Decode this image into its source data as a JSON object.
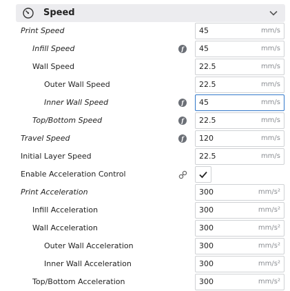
{
  "section": {
    "title": "Speed",
    "icon": "speedometer-icon",
    "collapse_icon": "chevron-down-icon"
  },
  "settings": [
    {
      "label": "Print Speed",
      "value": "45",
      "unit": "mm/s",
      "italic": true,
      "fx": false
    },
    {
      "label": "Infill Speed",
      "value": "45",
      "unit": "mm/s",
      "italic": true,
      "fx": true
    },
    {
      "label": "Wall Speed",
      "value": "22.5",
      "unit": "mm/s",
      "italic": false,
      "fx": false
    },
    {
      "label": "Outer Wall Speed",
      "value": "22.5",
      "unit": "mm/s",
      "italic": false,
      "fx": false
    },
    {
      "label": "Inner Wall Speed",
      "value": "45",
      "unit": "mm/s",
      "italic": true,
      "fx": true,
      "focused": true
    },
    {
      "label": "Top/Bottom Speed",
      "value": "22.5",
      "unit": "mm/s",
      "italic": true,
      "fx": true
    },
    {
      "label": "Travel Speed",
      "value": "120",
      "unit": "mm/s",
      "italic": true,
      "fx": true
    },
    {
      "label": "Initial Layer Speed",
      "value": "22.5",
      "unit": "mm/s",
      "italic": false,
      "fx": false
    },
    {
      "label": "Enable Acceleration Control",
      "checked": true,
      "italic": false,
      "linked": true
    },
    {
      "label": "Print Acceleration",
      "value": "300",
      "unit": "mm/s²",
      "italic": true,
      "fx": false
    },
    {
      "label": "Infill Acceleration",
      "value": "300",
      "unit": "mm/s²",
      "italic": false,
      "fx": false
    },
    {
      "label": "Wall Acceleration",
      "value": "300",
      "unit": "mm/s²",
      "italic": false,
      "fx": false
    },
    {
      "label": "Outer Wall Acceleration",
      "value": "300",
      "unit": "mm/s²",
      "italic": false,
      "fx": false
    },
    {
      "label": "Inner Wall Acceleration",
      "value": "300",
      "unit": "mm/s²",
      "italic": false,
      "fx": false
    },
    {
      "label": "Top/Bottom Acceleration",
      "value": "300",
      "unit": "mm/s²",
      "italic": false,
      "fx": false
    }
  ],
  "colors": {
    "focus_border": "#2f76c9",
    "header_bg": "#ececef",
    "fx_badge": "#6b6f76"
  }
}
